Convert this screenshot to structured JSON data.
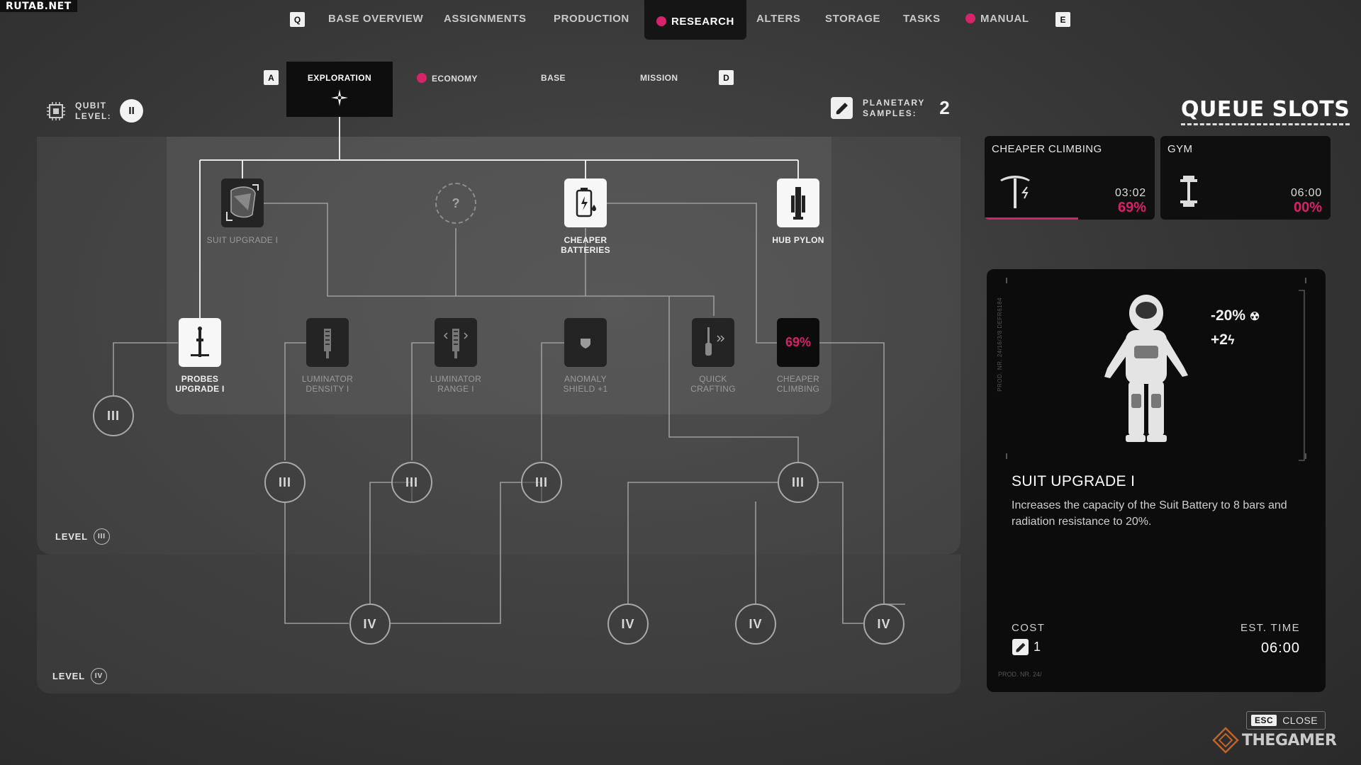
{
  "watermark": "RUTAB.NET",
  "nav": {
    "key_prev": "Q",
    "key_next": "E",
    "items": [
      {
        "label": "BASE OVERVIEW"
      },
      {
        "label": "ASSIGNMENTS"
      },
      {
        "label": "PRODUCTION"
      },
      {
        "label": "RESEARCH"
      },
      {
        "label": "ALTERS"
      },
      {
        "label": "STORAGE"
      },
      {
        "label": "TASKS"
      },
      {
        "label": "MANUAL"
      }
    ]
  },
  "subtabs": {
    "key_prev": "A",
    "key_next": "D",
    "items": [
      {
        "label": "EXPLORATION"
      },
      {
        "label": "ECONOMY"
      },
      {
        "label": "BASE"
      },
      {
        "label": "MISSION"
      }
    ]
  },
  "qubit": {
    "label_line1": "QUBIT",
    "label_line2": "LEVEL:",
    "value": "II"
  },
  "planetary": {
    "label_line1": "PLANETARY",
    "label_line2": "SAMPLES:",
    "value": "2"
  },
  "tree": {
    "nodes": [
      {
        "label": "SUIT UPGRADE I"
      },
      {
        "label": "CHEAPER",
        "label2": "BATTERIES"
      },
      {
        "label": "HUB PYLON"
      },
      {
        "label": "PROBES",
        "label2": "UPGRADE I"
      },
      {
        "label": "LUMINATOR",
        "label2": "DENSITY I"
      },
      {
        "label": "LUMINATOR",
        "label2": "RANGE I"
      },
      {
        "label": "ANOMALY",
        "label2": "SHIELD +1"
      },
      {
        "label": "QUICK",
        "label2": "CRAFTING"
      },
      {
        "label": "CHEAPER",
        "label2": "CLIMBING",
        "percent": "69%"
      }
    ],
    "unknown_mark": "?",
    "level3_mark": "III",
    "level4_mark": "IV",
    "level3_label": "LEVEL",
    "level4_label": "LEVEL"
  },
  "queue": {
    "title": "QUEUE SLOTS",
    "slots": [
      {
        "title": "CHEAPER CLIMBING",
        "time": "03:02",
        "percent": "69%",
        "icon": "pickaxe-icon",
        "progress": 0.55
      },
      {
        "title": "GYM",
        "time": "06:00",
        "percent": "00%",
        "icon": "dumbbell-icon",
        "progress": 0
      }
    ]
  },
  "detail": {
    "title": "SUIT UPGRADE I",
    "description": "Increases the capacity of the Suit Battery to 8 bars and radiation resistance to 20%.",
    "stat1": "-20%",
    "stat2": "+2",
    "cost_label": "COST",
    "cost_value": "1",
    "est_label": "EST. TIME",
    "est_value": "06:00",
    "vert_text": "PROD. NR. 24/16/3/8 DEFR6184",
    "prod_small": "PROD. NR. 24/"
  },
  "close": {
    "key": "ESC",
    "label": "CLOSE"
  },
  "brand": "THEGAMER",
  "colors": {
    "accent": "#d9206a",
    "panel": "#0c0c0c"
  }
}
